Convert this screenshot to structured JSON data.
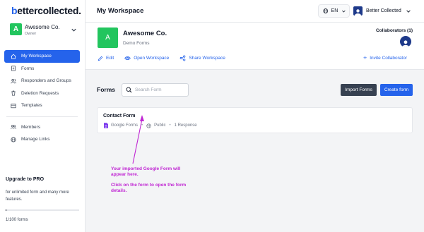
{
  "brand": {
    "prefix": "b",
    "rest": "ettercollected."
  },
  "workspace": {
    "initial": "A",
    "name": "Awesome Co.",
    "role": "Owner",
    "description": "Demo Forms"
  },
  "sidebar": {
    "items": [
      {
        "label": "My Workspace",
        "icon": "home-icon",
        "active": true
      },
      {
        "label": "Forms",
        "icon": "form-icon"
      },
      {
        "label": "Responders and Groups",
        "icon": "users-icon"
      },
      {
        "label": "Deletion Requests",
        "icon": "trash-icon"
      },
      {
        "label": "Templates",
        "icon": "template-icon"
      }
    ],
    "items2": [
      {
        "label": "Members",
        "icon": "members-icon"
      },
      {
        "label": "Manage Links",
        "icon": "globe-icon"
      }
    ]
  },
  "upgrade": {
    "title": "Upgrade to PRO",
    "description": "for unlimited form and many more features.",
    "usage": "1/100 forms",
    "progress": 0.01
  },
  "topbar": {
    "title": "My Workspace",
    "language": "EN",
    "user_name": "Better Collected"
  },
  "header": {
    "collaborators_label": "Collaborators (1)",
    "actions": [
      {
        "label": "Edit",
        "icon": "pencil-icon"
      },
      {
        "label": "Open Workspace",
        "icon": "eye-icon"
      },
      {
        "label": "Share Workspace",
        "icon": "share-icon"
      }
    ],
    "invite_label": "Invite Collaborator"
  },
  "forms": {
    "title": "Forms",
    "search_placeholder": "Search Form",
    "import_label": "Import Forms",
    "create_label": "Create form",
    "items": [
      {
        "name": "Contact Form",
        "source": "Google Forms",
        "visibility": "Public",
        "responses": "1 Response"
      }
    ]
  },
  "annotation": {
    "line1": "Your imported Google Form will appear here.",
    "line2": "Click on the form to open the form details."
  },
  "colors": {
    "accent": "#2563eb",
    "workspace_avatar": "#22c55e",
    "annotation": "#c026d3"
  }
}
